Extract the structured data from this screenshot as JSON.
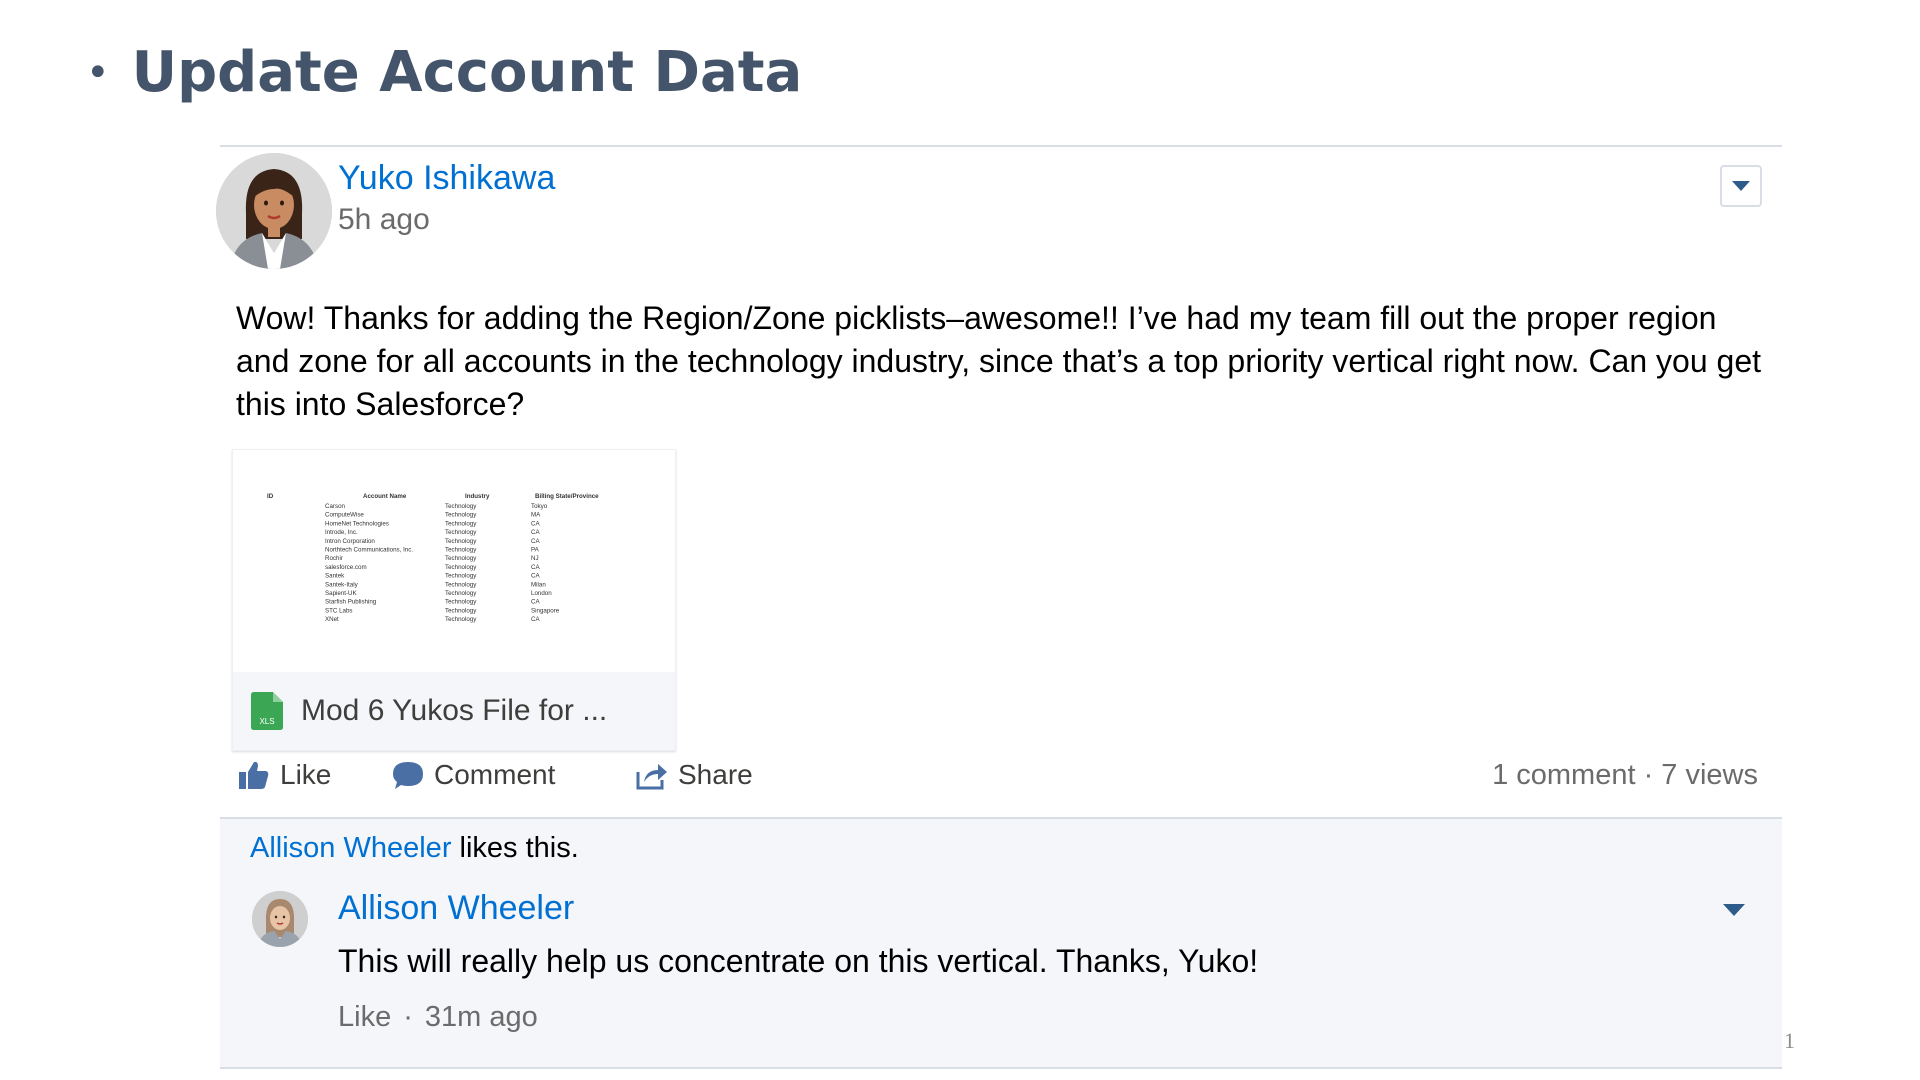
{
  "slide": {
    "bullet": "•",
    "title": "Update Account Data",
    "page_number": "1"
  },
  "post": {
    "author": "Yuko Ishikawa",
    "timestamp": "5h ago",
    "body": "Wow! Thanks for adding the Region/Zone picklists–awesome!! I’ve had my team fill out the proper region and zone for all accounts in the technology industry, since that’s a top priority vertical right now. Can you get this into Salesforce?",
    "attachment": {
      "name": "Mod 6 Yukos File for ...",
      "icon": "xls-file-icon",
      "icon_label": "XLS",
      "preview": {
        "headers": [
          "ID",
          "Account Name",
          "Industry",
          "Billing State/Province"
        ],
        "rows": [
          [
            "Carson",
            "Technology",
            "Tokyo"
          ],
          [
            "ComputeWise",
            "Technology",
            "MA"
          ],
          [
            "HomeNet Technologies",
            "Technology",
            "CA"
          ],
          [
            "Introde, Inc.",
            "Technology",
            "CA"
          ],
          [
            "Intron Corporation",
            "Technology",
            "CA"
          ],
          [
            "Northtech Communications, Inc.",
            "Technology",
            "PA"
          ],
          [
            "Rochir",
            "Technology",
            "NJ"
          ],
          [
            "salesforce.com",
            "Technology",
            "CA"
          ],
          [
            "Santek",
            "Technology",
            "CA"
          ],
          [
            "Santek-Italy",
            "Technology",
            "Milan"
          ],
          [
            "Sapient-UK",
            "Technology",
            "London"
          ],
          [
            "Starfish Publishing",
            "Technology",
            "CA"
          ],
          [
            "STC Labs",
            "Technology",
            "Singapore"
          ],
          [
            "XNet",
            "Technology",
            "CA"
          ]
        ]
      }
    },
    "actions": {
      "like": "Like",
      "comment": "Comment",
      "share": "Share"
    },
    "stats": "1 comment · 7 views",
    "liked_by": "Allison Wheeler",
    "liked_suffix": " likes this."
  },
  "comment": {
    "author": "Allison Wheeler",
    "body": "This will really help us concentrate on this vertical. Thanks, Yuko!",
    "like_label": "Like",
    "separator": "·",
    "timestamp": "31m ago"
  },
  "colors": {
    "title": "#44546a",
    "link": "#0070d2",
    "panel_bg": "#f4f6f9",
    "border": "#d8dde6",
    "xls_green": "#3ba755"
  }
}
